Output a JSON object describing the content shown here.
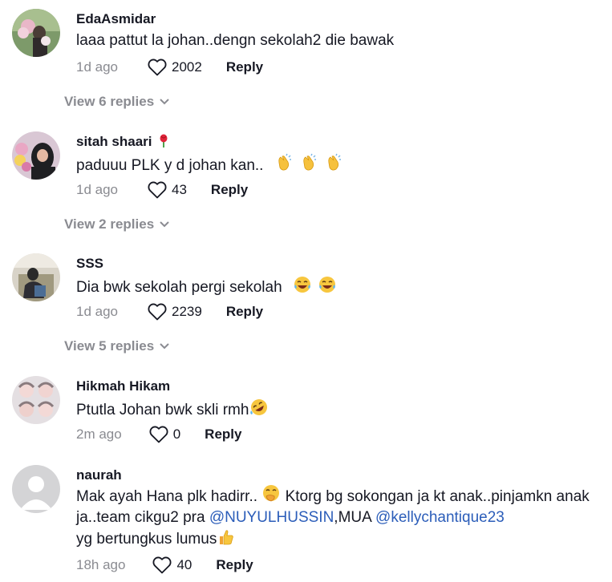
{
  "comments": [
    {
      "username": "EdaAsmidar",
      "text": "laaa pattut la johan..dengn sekolah2 die bawak",
      "time": "1d ago",
      "likes": "2002",
      "reply_label": "Reply",
      "view_replies": "View 6 replies",
      "avatar_icon": "avatar-photo-flowers"
    },
    {
      "username": "sitah shaari",
      "username_emoji": "rose-icon",
      "text": "paduuu PLK y d johan kan..",
      "text_emojis": [
        "clap-icon",
        "clap-icon",
        "clap-icon"
      ],
      "time": "1d ago",
      "likes": "43",
      "reply_label": "Reply",
      "view_replies": "View 2 replies",
      "avatar_icon": "avatar-photo-hijab"
    },
    {
      "username": "SSS",
      "text": "Dia bwk sekolah pergi sekolah",
      "text_emojis": [
        "laughing-tears-icon",
        "laughing-tears-icon"
      ],
      "time": "1d ago",
      "likes": "2239",
      "reply_label": "Reply",
      "view_replies": "View 5 replies",
      "avatar_icon": "avatar-photo-seated"
    },
    {
      "username": "Hikmah Hikam",
      "text": "Ptutla Johan bwk skli rmh",
      "text_emojis": [
        "rofl-icon"
      ],
      "time": "2m ago",
      "likes": "0",
      "reply_label": "Reply",
      "avatar_icon": "avatar-photo-faces"
    },
    {
      "username": "naurah",
      "text_part1": "Mak ayah Hana plk hadirr..",
      "text_part2": "Ktorg bg sokongan ja kt anak..pinjamkn anak ja..team cikgu2 pra",
      "mention1": "@NUYULHUSSIN",
      "text_part3": ",MUA",
      "mention2": "@kellychantique23",
      "text_part4": "yg bertungkus lumus",
      "text_emojis": [
        "hand-over-mouth-icon",
        "thumbs-up-icon"
      ],
      "time": "18h ago",
      "likes": "40",
      "reply_label": "Reply",
      "avatar_icon": "default-avatar-icon"
    }
  ],
  "colors": {
    "text": "#161823",
    "muted": "#8a8b91",
    "mention": "#2b5db9"
  }
}
